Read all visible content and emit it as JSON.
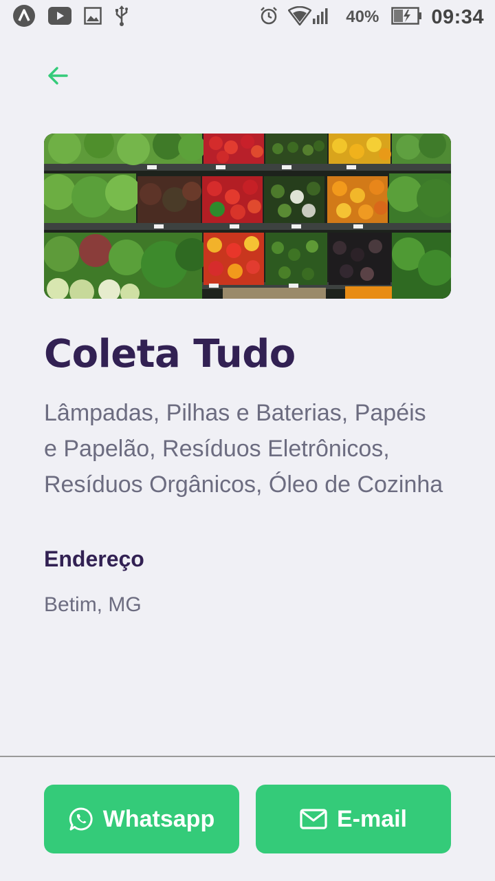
{
  "status_bar": {
    "battery": "40%",
    "time": "09:34",
    "icons": [
      "app-logo-icon",
      "youtube-icon",
      "image-icon",
      "usb-icon",
      "alarm-icon",
      "wifi-icon",
      "signal-icon",
      "battery-charging-icon"
    ]
  },
  "point": {
    "name": "Coleta Tudo",
    "items_line1": "Lâmpadas, Pilhas e Baterias, Papéis",
    "items_line2": "e Papelão, Resíduos Eletrônicos,",
    "items_line3": "Resíduos Orgânicos, Óleo de Cozinha",
    "address_title": "Endereço",
    "address": "Betim, MG"
  },
  "footer": {
    "whatsapp_label": "Whatsapp",
    "email_label": "E-mail"
  },
  "colors": {
    "accent": "#34CB79",
    "title": "#322153",
    "text": "#6C6C80",
    "background": "#F0F0F5"
  }
}
